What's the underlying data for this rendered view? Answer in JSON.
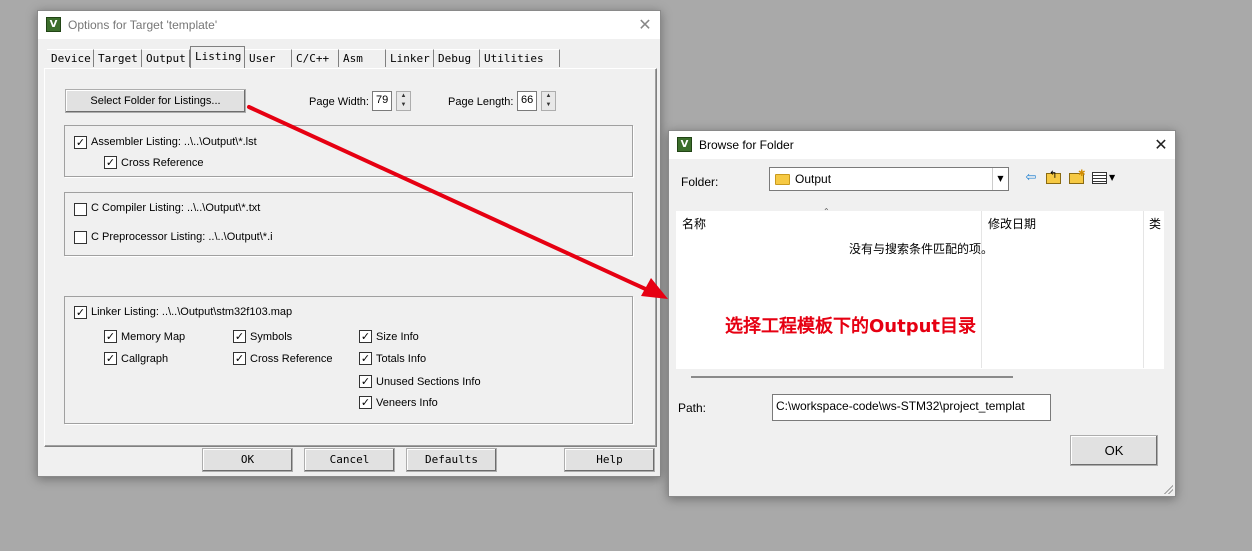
{
  "options_dialog": {
    "title": "Options for Target 'template'",
    "tabs": [
      "Device",
      "Target",
      "Output",
      "Listing",
      "User",
      "C/C++",
      "Asm",
      "Linker",
      "Debug",
      "Utilities"
    ],
    "active_tab": "Listing",
    "select_folder_label": "Select Folder for Listings...",
    "page_width_label": "Page Width:",
    "page_width_value": "79",
    "page_length_label": "Page Length:",
    "page_length_value": "66",
    "assembler_listing": "Assembler Listing:  ..\\..\\Output\\*.lst",
    "cross_reference": "Cross Reference",
    "c_compiler_listing": "C Compiler Listing:  ..\\..\\Output\\*.txt",
    "c_preprocessor_listing": "C Preprocessor Listing:  ..\\..\\Output\\*.i",
    "linker_listing": "Linker Listing:  ..\\..\\Output\\stm32f103.map",
    "linker_options": {
      "memory_map": "Memory Map",
      "symbols": "Symbols",
      "size_info": "Size Info",
      "callgraph": "Callgraph",
      "cross_reference": "Cross Reference",
      "totals_info": "Totals Info",
      "unused_sections_info": "Unused Sections Info",
      "veneers_info": "Veneers Info"
    },
    "buttons": {
      "ok": "OK",
      "cancel": "Cancel",
      "defaults": "Defaults",
      "help": "Help"
    }
  },
  "browse_dialog": {
    "title": "Browse for Folder",
    "folder_label": "Folder:",
    "folder_value": "Output",
    "columns": [
      "名称",
      "修改日期",
      "类"
    ],
    "empty_message": "没有与搜索条件匹配的项。",
    "path_label": "Path:",
    "path_value": "C:\\workspace-code\\ws-STM32\\project_templat",
    "ok_label": "OK"
  },
  "annotation": {
    "text": "选择工程模板下的Output目录",
    "color": "#e60012"
  },
  "icons": {
    "app": "V",
    "close": "✕",
    "check": "✓"
  }
}
